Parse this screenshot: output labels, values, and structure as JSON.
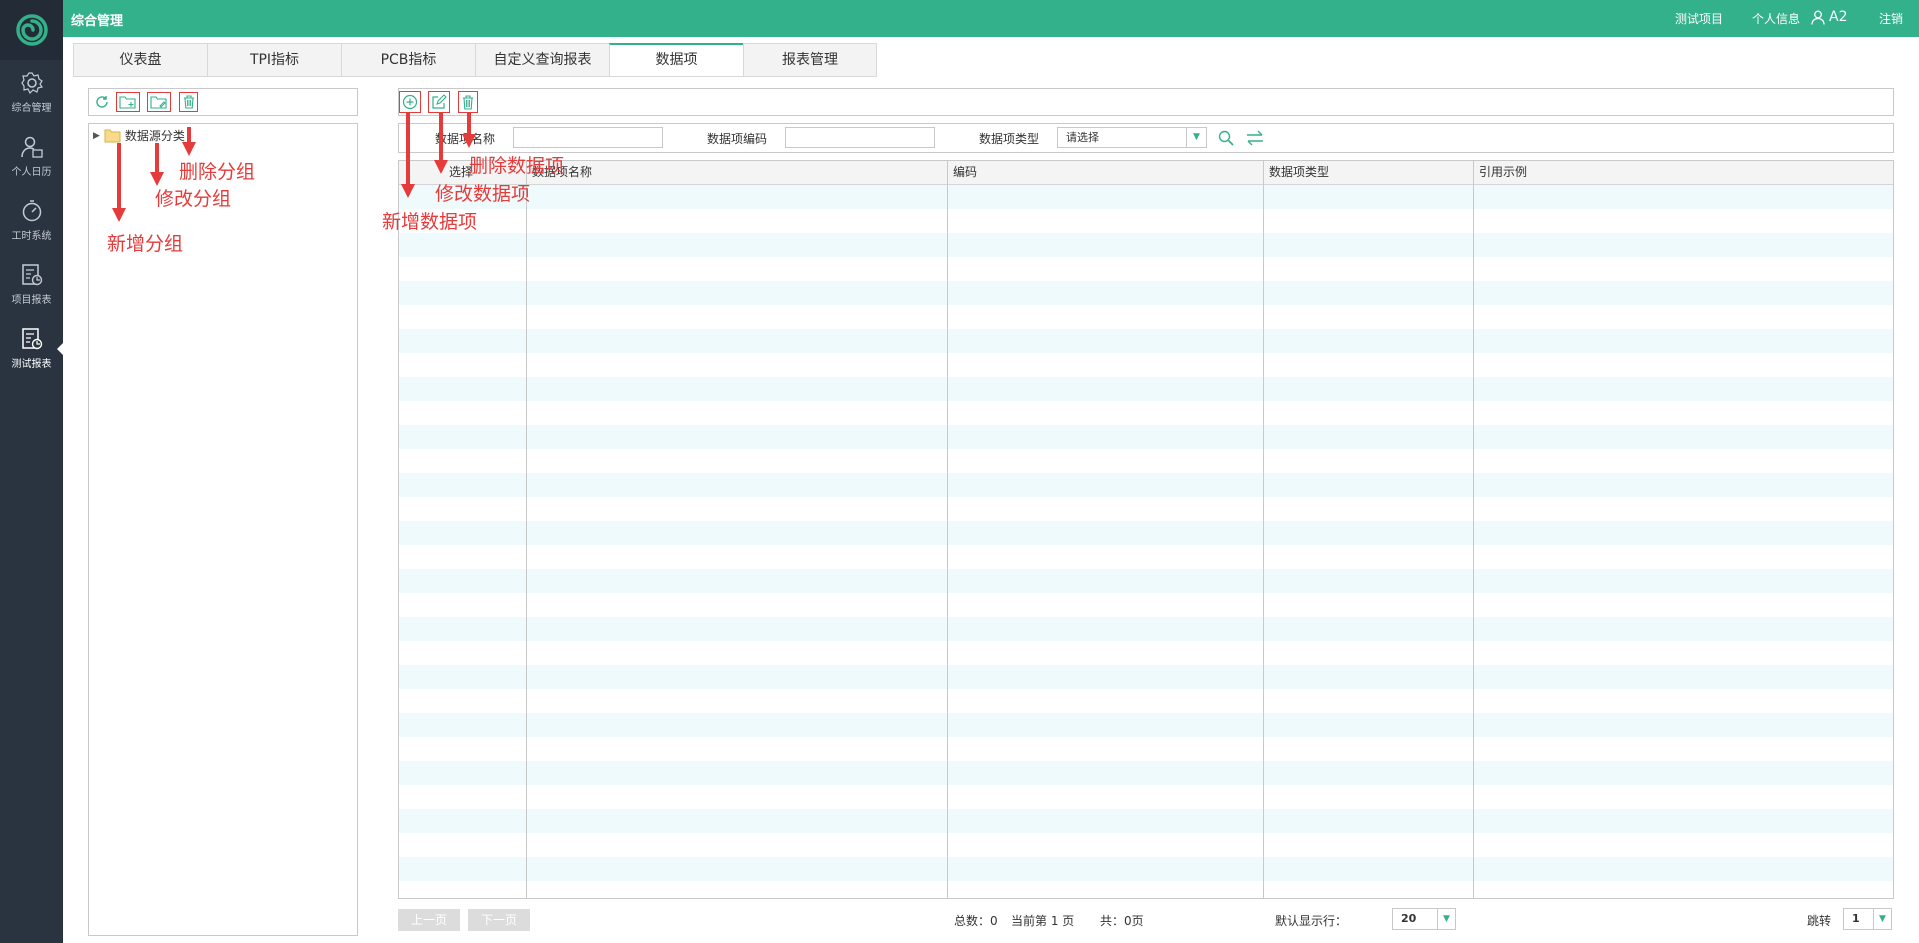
{
  "topbar": {
    "title": "综合管理",
    "project": "测试项目",
    "profile": "个人信息",
    "user": "A2",
    "logout": "注销"
  },
  "sidebar": {
    "items": [
      {
        "label": "综合管理",
        "icon": "gear-icon"
      },
      {
        "label": "个人日历",
        "icon": "person-calendar-icon"
      },
      {
        "label": "工时系统",
        "icon": "stopwatch-icon"
      },
      {
        "label": "项目报表",
        "icon": "report-chart-icon"
      },
      {
        "label": "测试报表",
        "icon": "report-chart-icon"
      }
    ],
    "active_index": 4
  },
  "tabs": [
    {
      "label": "仪表盘"
    },
    {
      "label": "TPI指标"
    },
    {
      "label": "PCB指标"
    },
    {
      "label": "自定义查询报表"
    },
    {
      "label": "数据项"
    },
    {
      "label": "报表管理"
    }
  ],
  "tree": {
    "root_label": "数据源分类"
  },
  "annotations": {
    "add_group": "新增分组",
    "edit_group": "修改分组",
    "delete_group": "删除分组",
    "add_item": "新增数据项",
    "edit_item": "修改数据项",
    "delete_item": "删除数据项"
  },
  "search": {
    "name_label": "数据项名称",
    "code_label": "数据项编码",
    "type_label": "数据项类型",
    "type_placeholder": "请选择"
  },
  "grid": {
    "columns": [
      "选择",
      "数据项名称",
      "编码",
      "数据项类型",
      "引用示例"
    ],
    "rows": []
  },
  "footer": {
    "prev": "上一页",
    "next": "下一页",
    "total": "总数：0",
    "current": "当前第 1 页",
    "pages": "共：0页",
    "page_size_label": "默认显示行：",
    "page_size": "20",
    "jump_label": "跳转",
    "jump_page": "1"
  },
  "colors": {
    "accent": "#33b18a",
    "sidebar": "#2a3441",
    "annotation": "#e53b3b"
  }
}
